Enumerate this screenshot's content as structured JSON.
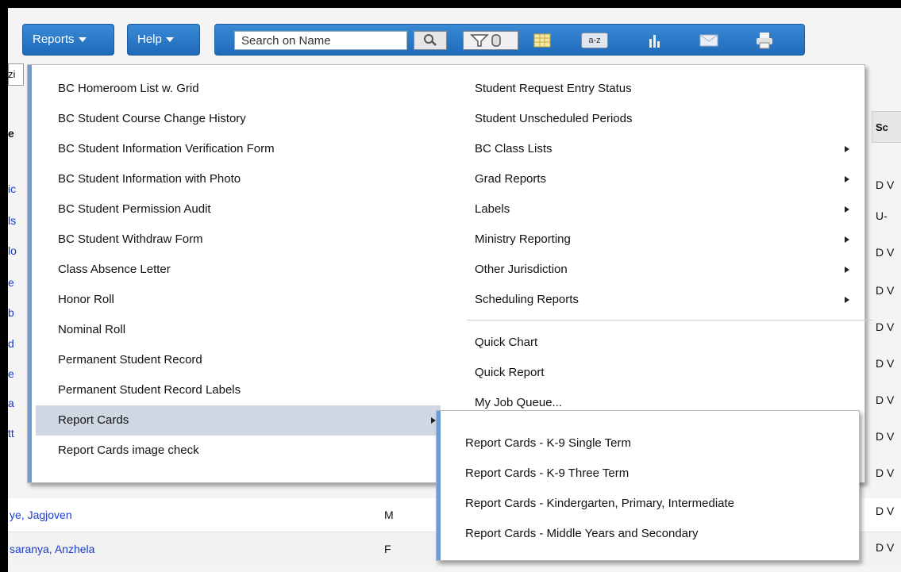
{
  "toolbar": {
    "reports_label": "Reports",
    "help_label": "Help",
    "search_placeholder": "Search on Name",
    "sort_icon_text": "a-z"
  },
  "table": {
    "header_right": "Sc",
    "left_fragments": [
      "zi",
      "e",
      "ic",
      "ls",
      "lo",
      "e",
      "b",
      "d",
      "e",
      "a",
      "tt"
    ],
    "rows": [
      {
        "name": "ye, Jagjoven",
        "gender": "M"
      },
      {
        "name": "saranya, Anzhela",
        "gender": "F"
      }
    ],
    "right_fragments": [
      "D V",
      "U-",
      "D V",
      "D V",
      "D V",
      "D V",
      "D V",
      "D V",
      "D V",
      "D V",
      "D V"
    ]
  },
  "reports_menu": {
    "left_items": [
      "BC Homeroom List w. Grid",
      "BC Student Course Change History",
      "BC Student Information Verification Form",
      "BC Student Information with Photo",
      "BC Student Permission Audit",
      "BC Student Withdraw Form",
      "Class Absence Letter",
      "Honor Roll",
      "Nominal Roll",
      "Permanent Student Record",
      "Permanent Student Record Labels",
      "Report Cards",
      "Report Cards image check"
    ],
    "right_items": [
      "Student Request Entry Status",
      "Student Unscheduled Periods",
      "BC Class Lists",
      "Grad Reports",
      "Labels",
      "Ministry Reporting",
      "Other Jurisdiction",
      "Scheduling Reports",
      "Quick Chart",
      "Quick Report",
      "My Job Queue..."
    ]
  },
  "report_cards_submenu": [
    "Report Cards - K-9 Single Term",
    "Report Cards - K-9 Three Term",
    "Report Cards - Kindergarten, Primary, Intermediate",
    "Report Cards - Middle Years and Secondary"
  ],
  "colors": {
    "toolbar_blue": "#2a78c9",
    "menu_accent": "#6d9bd6",
    "highlight": "#cfd7e3",
    "link": "#1a3dcc"
  }
}
